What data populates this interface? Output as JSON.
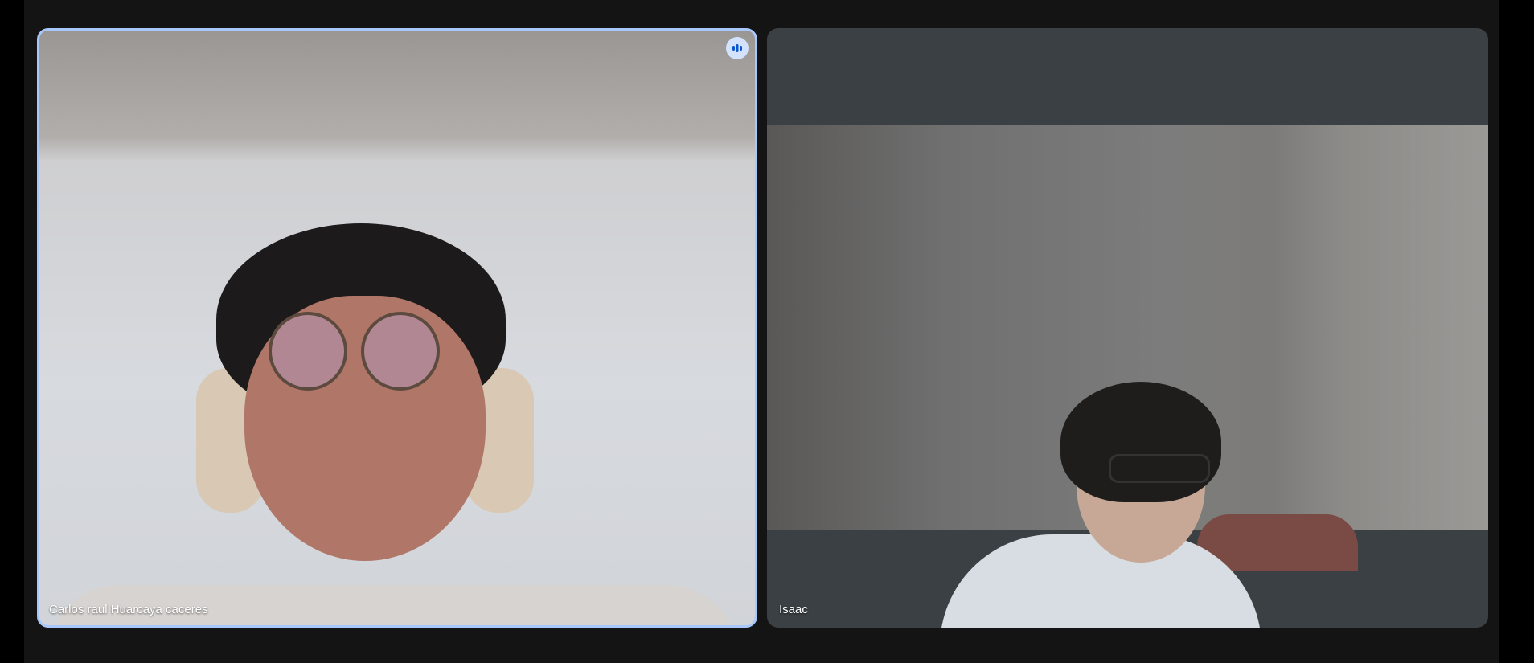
{
  "meeting": {
    "participants": [
      {
        "name": "Carlos raul Huarcaya caceres",
        "speaking": true
      },
      {
        "name": "Isaac",
        "speaking": false
      }
    ]
  },
  "colors": {
    "background": "#141414",
    "tile_background": "#3b4044",
    "active_speaker_border": "#a8c7fa",
    "speaking_indicator_bg": "#d3e3fd",
    "speaking_indicator_fg": "#0b57d0"
  },
  "icons": {
    "speaking_indicator": "audio-bars-icon"
  }
}
